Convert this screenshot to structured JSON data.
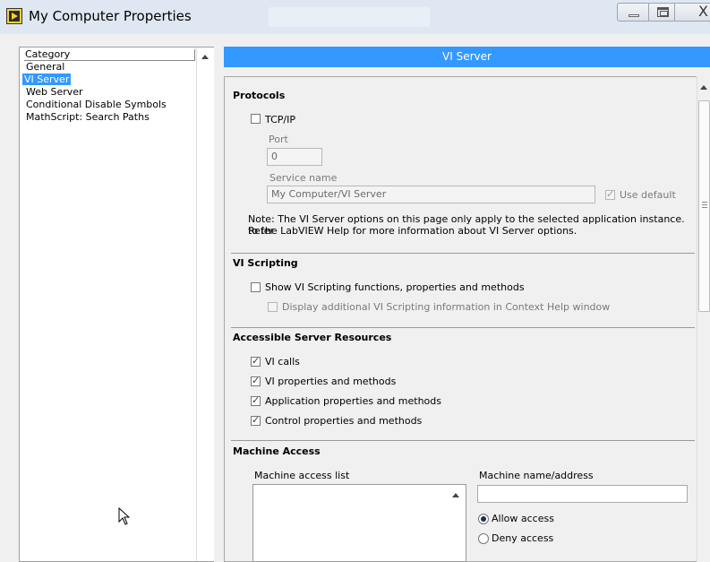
{
  "window": {
    "title": "My Computer Properties",
    "close_glyph": "X"
  },
  "category": {
    "header": "Category",
    "items": [
      "General",
      "VI Server",
      "Web Server",
      "Conditional Disable Symbols",
      "MathScript: Search Paths"
    ],
    "selected": "VI Server"
  },
  "section_header": "VI Server",
  "protocols": {
    "title": "Protocols",
    "tcpip_label": "TCP/IP",
    "tcpip_checked": false,
    "port_label": "Port",
    "port_value": "0",
    "service_name_label": "Service name",
    "service_name_value": "My Computer/VI Server",
    "use_default_label": "Use default",
    "use_default_checked": true,
    "note_line1": "Note: The VI Server options on this page only apply to the selected application instance. Refer",
    "note_line2": "to the LabVIEW Help for more information about VI Server options."
  },
  "scripting": {
    "title": "VI Scripting",
    "show_label": "Show VI Scripting functions, properties and methods",
    "show_checked": false,
    "display_label": "Display additional VI Scripting information in Context Help window",
    "display_checked": false
  },
  "resources": {
    "title": "Accessible Server Resources",
    "items": [
      {
        "label": "VI calls",
        "checked": true
      },
      {
        "label": "VI properties and methods",
        "checked": true
      },
      {
        "label": "Application properties and methods",
        "checked": true
      },
      {
        "label": "Control properties and methods",
        "checked": true
      }
    ]
  },
  "machine_access": {
    "title": "Machine Access",
    "list_label": "Machine access list",
    "name_label": "Machine name/address",
    "name_value": "",
    "allow_label": "Allow access",
    "deny_label": "Deny access",
    "selected": "allow"
  },
  "icons": {
    "app": "labview-app-icon",
    "minimize": "minimize-icon",
    "maximize": "maximize-icon",
    "close": "close-icon",
    "scroll_up": "scroll-up-arrow-icon",
    "cursor": "mouse-pointer-icon"
  },
  "colors": {
    "accent": "#3399ff",
    "titlebar": "#dfe8f2"
  }
}
